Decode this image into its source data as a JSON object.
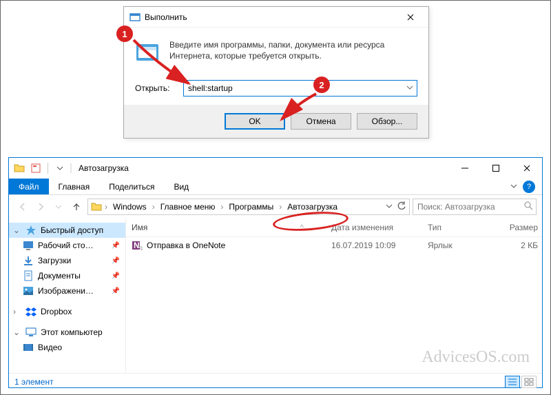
{
  "run_dialog": {
    "title": "Выполнить",
    "description": "Введите имя программы, папки, документа или ресурса Интернета, которые требуется открыть.",
    "open_label": "Открыть:",
    "input_value": "shell:startup",
    "ok": "OK",
    "cancel": "Отмена",
    "browse": "Обзор..."
  },
  "callouts": {
    "one": "1",
    "two": "2"
  },
  "explorer": {
    "title": "Автозагрузка",
    "ribbon": {
      "file": "Файл",
      "home": "Главная",
      "share": "Поделиться",
      "view": "Вид"
    },
    "breadcrumbs": [
      "Windows",
      "Главное меню",
      "Программы",
      "Автозагрузка"
    ],
    "search_placeholder": "Поиск: Автозагрузка",
    "columns": {
      "name": "Имя",
      "date": "Дата изменения",
      "type": "Тип",
      "size": "Размер"
    },
    "sidebar": {
      "quick_access": "Быстрый доступ",
      "desktop": "Рабочий сто…",
      "downloads": "Загрузки",
      "documents": "Документы",
      "pictures": "Изображени…",
      "dropbox": "Dropbox",
      "this_pc": "Этот компьютер",
      "videos": "Видео"
    },
    "rows": [
      {
        "name": "Отправка в OneNote",
        "date": "16.07.2019 10:09",
        "type": "Ярлык",
        "size": "2 КБ"
      }
    ],
    "status": "1 элемент"
  },
  "watermark": "AdvicesOS.com"
}
